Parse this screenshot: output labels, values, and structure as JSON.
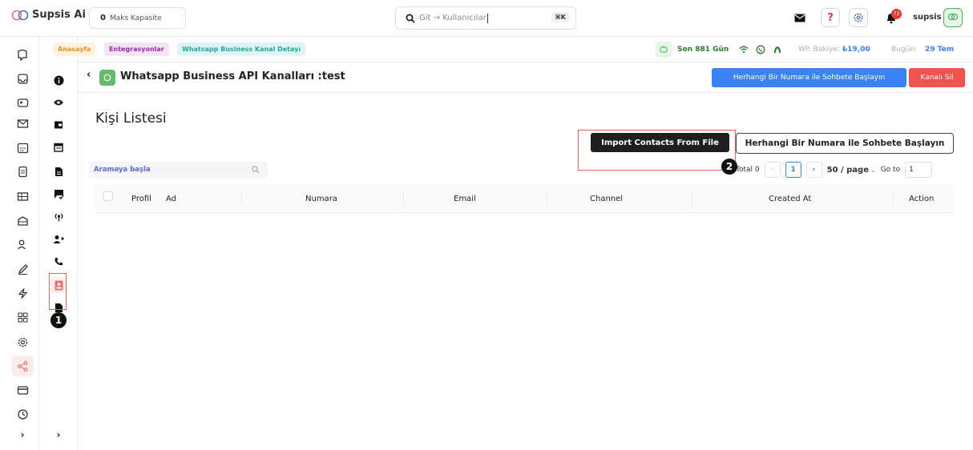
{
  "app": {
    "name": "Supsis Ai",
    "username": "supsis"
  },
  "capacity": {
    "value": "0",
    "label": "Maks Kapasite"
  },
  "search": {
    "text": "Git → Kullanıcılar",
    "shortcut": "⌘K"
  },
  "notifications": {
    "count": "72"
  },
  "breadcrumb": [
    "Anasayfa",
    "Entegrasyonlar",
    "Whatsapp Business Kanal Detayı"
  ],
  "status": {
    "days": "Son 881 Gün",
    "balance_label": "WP. Bakiye:",
    "balance_value": "₺19,00",
    "today_label": "Bugün:",
    "today_value": "29 Tem"
  },
  "page": {
    "title": "Whatsapp Business API Kanalları :test",
    "start_chat_label": "Herhangi Bir Numara ile Sohbete Başlayın",
    "delete_label": "Kanalı Sil"
  },
  "contacts": {
    "title": "Kişi Listesi",
    "import_label": "Import Contacts From File",
    "start_chat_label": "Herhangi Bir Numara ile Sohbete Başlayın",
    "search_placeholder": "Aramaya başla",
    "total": "Total 0",
    "current_page": "1",
    "page_size": "50 / page",
    "goto_label": "Go to",
    "goto_value": "1",
    "columns": [
      "Profil",
      "Ad",
      "Numara",
      "Email",
      "Channel",
      "Created At",
      "Action"
    ]
  },
  "annotations": {
    "marker1": "1",
    "marker2": "2"
  },
  "colors": {
    "accent_blue": "#3b82f6",
    "danger": "#ef5350",
    "highlight": "#e46a5a",
    "brand_green": "#4caf50"
  }
}
